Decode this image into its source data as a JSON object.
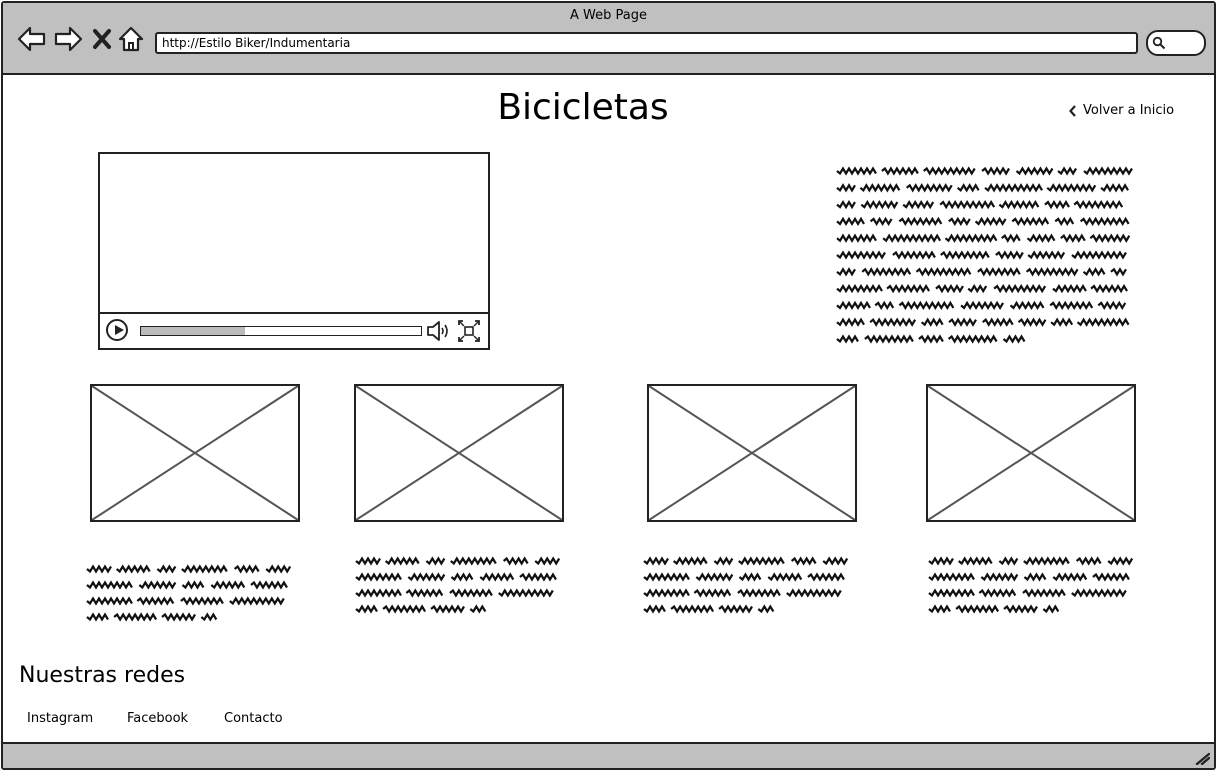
{
  "window": {
    "title": "A Web Page"
  },
  "browser": {
    "url": "http://Estilo Biker/Indumentaria"
  },
  "page": {
    "title": "Bicicletas",
    "back_link": "Volver a Inicio"
  },
  "video": {
    "progress": 0.37
  },
  "footer": {
    "section_title": "Nuestras redes",
    "links": [
      "Instagram",
      "Facebook",
      "Contacto"
    ]
  },
  "icons": {
    "back": "arrow-left-icon",
    "forward": "arrow-right-icon",
    "stop": "close-icon",
    "home": "home-icon",
    "search": "search-icon",
    "back_link": "chevron-left-icon",
    "play": "play-icon",
    "volume": "volume-icon",
    "fullscreen": "fullscreen-icon",
    "resize": "resize-grip-icon"
  }
}
